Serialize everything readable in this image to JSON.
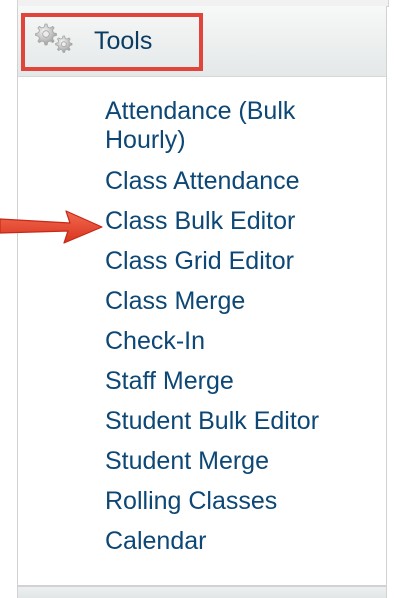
{
  "header": {
    "title": "Tools",
    "icon": "gears-icon",
    "highlight_color": "#e0443a"
  },
  "menu": {
    "items": [
      {
        "label": "Attendance (Bulk\nHourly)"
      },
      {
        "label": "Class Attendance"
      },
      {
        "label": "Class Bulk Editor"
      },
      {
        "label": "Class Grid Editor"
      },
      {
        "label": "Class Merge"
      },
      {
        "label": "Check-In"
      },
      {
        "label": "Staff Merge"
      },
      {
        "label": "Student Bulk Editor"
      },
      {
        "label": "Student Merge"
      },
      {
        "label": "Rolling Classes"
      },
      {
        "label": "Calendar"
      }
    ],
    "link_color": "#0d4775"
  },
  "annotation": {
    "pointer": "red-arrow",
    "points_to": "Class Bulk Editor",
    "color": "#e0443a"
  }
}
